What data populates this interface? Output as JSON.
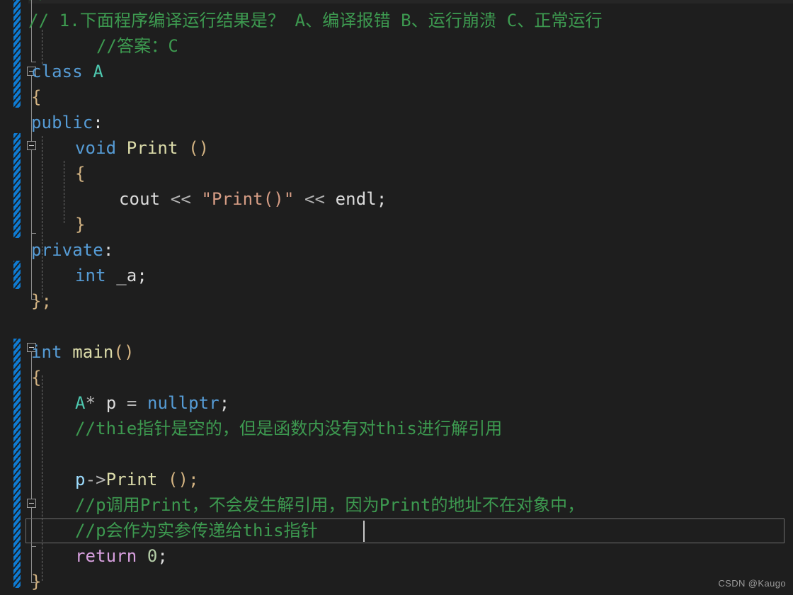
{
  "app": {
    "name": "visual-studio-code-editor",
    "theme": "dark",
    "background": "#1e1e1e",
    "language": "C++"
  },
  "watermark": {
    "text": "CSDN @Kaugo"
  },
  "colors": {
    "keyword": "#569cd6",
    "control_keyword": "#d8a0df",
    "type": "#4ec9b0",
    "function": "#dcdcaa",
    "string": "#d69d85",
    "comment": "#3d9a50",
    "plain": "#dcdcdc",
    "brace": "#d4b483",
    "changebar": "#0f7cd4",
    "outline": "#8a8a8a",
    "indent_guide": "#6e6e6e"
  },
  "editor": {
    "cursor_line_index": 21,
    "lines": [
      {
        "i": 0,
        "text": "//"
      },
      {
        "i": 1,
        "text": "// 1.下面程序编译运行结果是？ A、编译报错 B、运行崩溃 C、正常运行"
      },
      {
        "i": 2,
        "text": "        //答案：C"
      },
      {
        "i": 3,
        "text": "class A"
      },
      {
        "i": 4,
        "text": " {"
      },
      {
        "i": 5,
        "text": " public:"
      },
      {
        "i": 6,
        "text": "     void Print ()"
      },
      {
        "i": 7,
        "text": "     {"
      },
      {
        "i": 8,
        "text": "         cout << \"Print()\" << endl;"
      },
      {
        "i": 9,
        "text": "     }"
      },
      {
        "i": 10,
        "text": " private:"
      },
      {
        "i": 11,
        "text": "     int _a;"
      },
      {
        "i": 12,
        "text": " };"
      },
      {
        "i": 13,
        "text": ""
      },
      {
        "i": 14,
        "text": "int main()"
      },
      {
        "i": 15,
        "text": " {"
      },
      {
        "i": 16,
        "text": "     A* p = nullptr;"
      },
      {
        "i": 17,
        "text": "     //thie指针是空的，但是函数内没有对this进行解引用"
      },
      {
        "i": 18,
        "text": ""
      },
      {
        "i": 19,
        "text": "     p->Print ();"
      },
      {
        "i": 20,
        "text": "     //p调用Print，不会发生解引用，因为Print的地址不在对象中，"
      },
      {
        "i": 21,
        "text": "     //p会作为实参传递给this指针"
      },
      {
        "i": 22,
        "text": "     return 0;"
      },
      {
        "i": 23,
        "text": " }"
      }
    ],
    "tokens": {
      "l0_comment": "//",
      "l1_comment": "// 1.下面程序编译运行结果是？ A、编译报错 B、运行崩溃 C、正常运行",
      "l2_comment": "//答案：C",
      "l3_kw": "class",
      "l3_type": "A",
      "l4_brace": "{",
      "l5_kw": "public",
      "l5_colon": ":",
      "l6_kw": "void",
      "l6_fn": "Print",
      "l6_parens": "()",
      "l7_brace": "{",
      "l8_cout": "cout",
      "l8_shift1": "<<",
      "l8_str": "\"Print()\"",
      "l8_shift2": "<<",
      "l8_endl": "endl",
      "l8_semi": ";",
      "l9_brace": "}",
      "l10_kw": "private",
      "l10_colon": ":",
      "l11_kw": "int",
      "l11_var": "_a;",
      "l12_brace": "};",
      "l14_kw": "int",
      "l14_fn": "main",
      "l14_parens": "()",
      "l15_brace": "{",
      "l16_type": "A",
      "l16_star": "*",
      "l16_var": "p",
      "l16_eq": "=",
      "l16_kw": "nullptr",
      "l16_semi": ";",
      "l17_comment": "//thie指针是空的，但是函数内没有对this进行解引用",
      "l19_var": "p",
      "l19_arrow": "->",
      "l19_fn": "Print",
      "l19_call": "();",
      "l20_comment": "//p调用Print，不会发生解引用，因为Print的地址不在对象中，",
      "l21_comment": "//p会作为实参传递给this指针",
      "l22_kw": "return",
      "l22_num": "0",
      "l22_semi": ";",
      "l23_brace": "}"
    }
  }
}
